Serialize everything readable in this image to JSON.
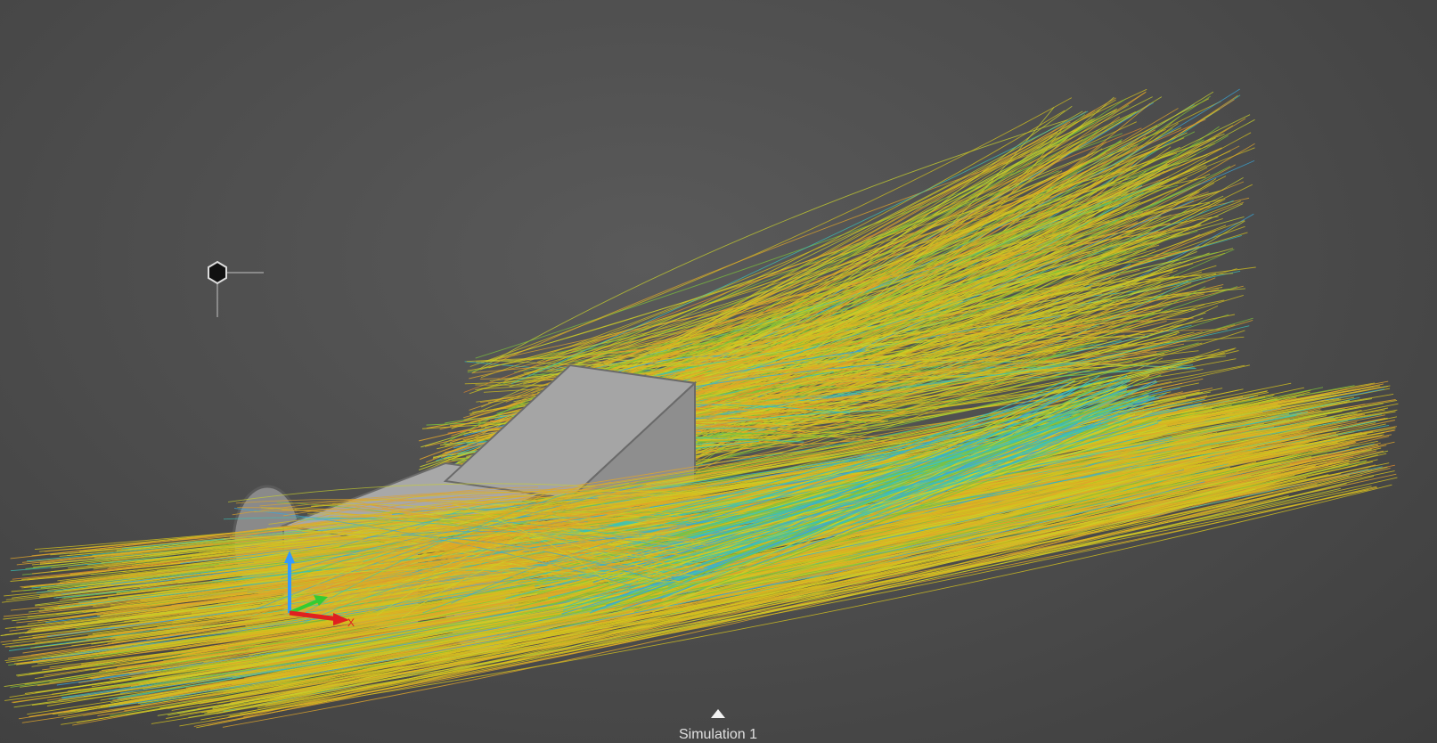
{
  "viewport": {
    "background_color": "#4e4e4e",
    "streamline_colors": [
      "#d4c21e",
      "#e0a52a",
      "#c9d12c",
      "#7cc23a",
      "#39c2b8",
      "#3aa7d8",
      "#e18a2c"
    ],
    "body_color": "#9a9a9a"
  },
  "light_widget": {
    "icon": "hexagon-light-icon"
  },
  "axis_triad": {
    "x_label": "X",
    "x_color": "#e02020",
    "y_color": "#33cc33",
    "z_color": "#3399ff"
  },
  "simulation_tab": {
    "label": "Simulation 1",
    "icon": "triangle-up-icon"
  }
}
